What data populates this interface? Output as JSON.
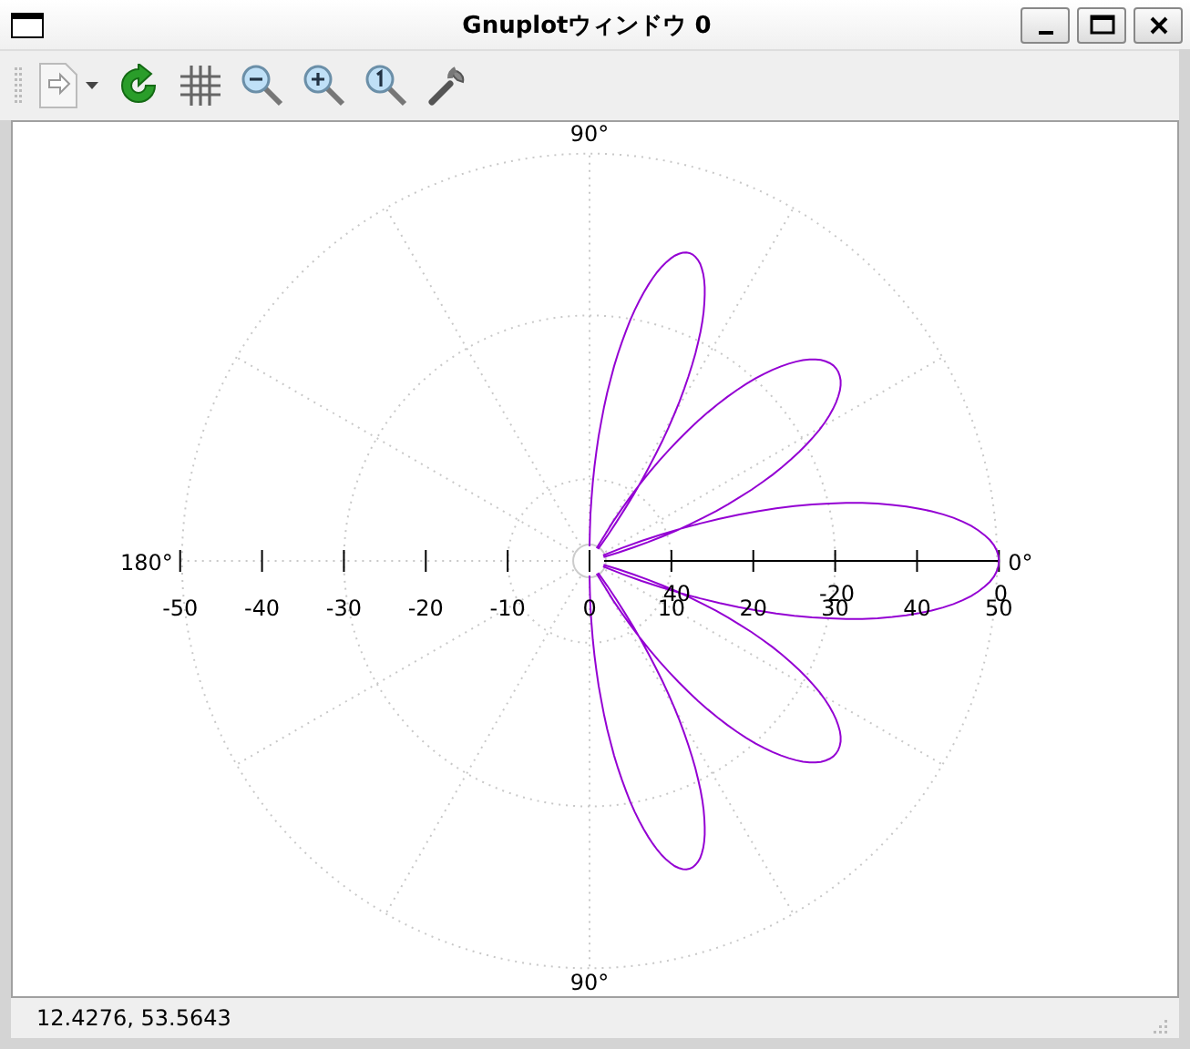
{
  "window": {
    "title": "Gnuplotウィンドウ 0"
  },
  "plot": {
    "angle_labels": [
      "90°",
      "180°",
      "0°",
      "90°"
    ],
    "r_axis_labels": [
      "-50",
      "-40",
      "-30",
      "-20",
      "-10",
      "0",
      "10",
      "20",
      "30",
      "40",
      "50"
    ],
    "overlapping_labels": [
      "40",
      "-20",
      "0"
    ]
  },
  "status_bar": {
    "text": "12.4276,  53.5643"
  }
}
